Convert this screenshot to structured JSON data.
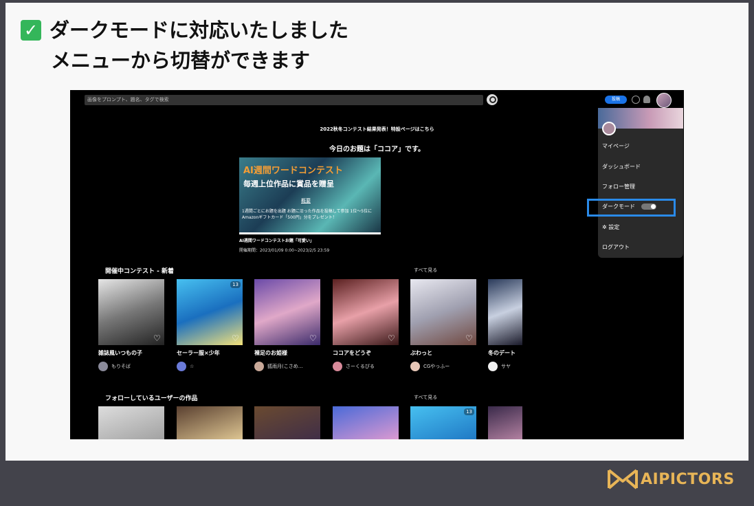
{
  "headline": {
    "line1": "ダークモードに対応いたしました",
    "line2": "メニューから切替ができます"
  },
  "brand": {
    "logo_text": "AIPICTORS"
  },
  "app": {
    "search_placeholder": "画像をプロンプト、題名、タグで検索",
    "post_label": "投稿",
    "notice": "2022秋冬コンテスト結果発表！特設ページはこちら",
    "today_topic": "今日のお題は「ココア」です。",
    "banner": {
      "title": "AI週間ワードコンテスト",
      "subtitle": "毎週上位作品に賞品を贈呈",
      "overview_label": "概要",
      "detail": "1週間ごとにお題を出題 お題に沿った作品を投稿して参加 1位〜5位にAmazonギフトカード「500円」分をプレゼント！"
    },
    "contest_name": "AI週間ワードコンテストお題「可愛い」",
    "contest_date": "開催期間：2023/01/09 0:00~2023/2/5 23:59",
    "section_contests": {
      "title": "開催中コンテスト - 新着",
      "see_all": "すべて見る",
      "cards": [
        {
          "title": "雑誌風いつもの子",
          "user": "もりそば"
        },
        {
          "title": "セーラー服×少年",
          "user": "☆",
          "count": "13"
        },
        {
          "title": "裸足のお姫様",
          "user": "狐雨月(こさめ…"
        },
        {
          "title": "ココアをどうぞ",
          "user": "さーくるぴる"
        },
        {
          "title": "ぶわっと",
          "user": "CGやっふー"
        },
        {
          "title": "冬のデート",
          "user": "サヤ"
        }
      ]
    },
    "section_follow": {
      "title": "フォローしているユーザーの作品",
      "see_all": "すべて見る",
      "badge_count": "13"
    },
    "menu": {
      "items": [
        "マイページ",
        "ダッシュボード",
        "フォロー管理",
        "ダークモード",
        "設定",
        "ログアウト"
      ],
      "settings_glyph": "✲"
    }
  },
  "colors": {
    "highlight": "#2a8ae8",
    "check": "#34b65a",
    "brand": "#e8b557"
  }
}
